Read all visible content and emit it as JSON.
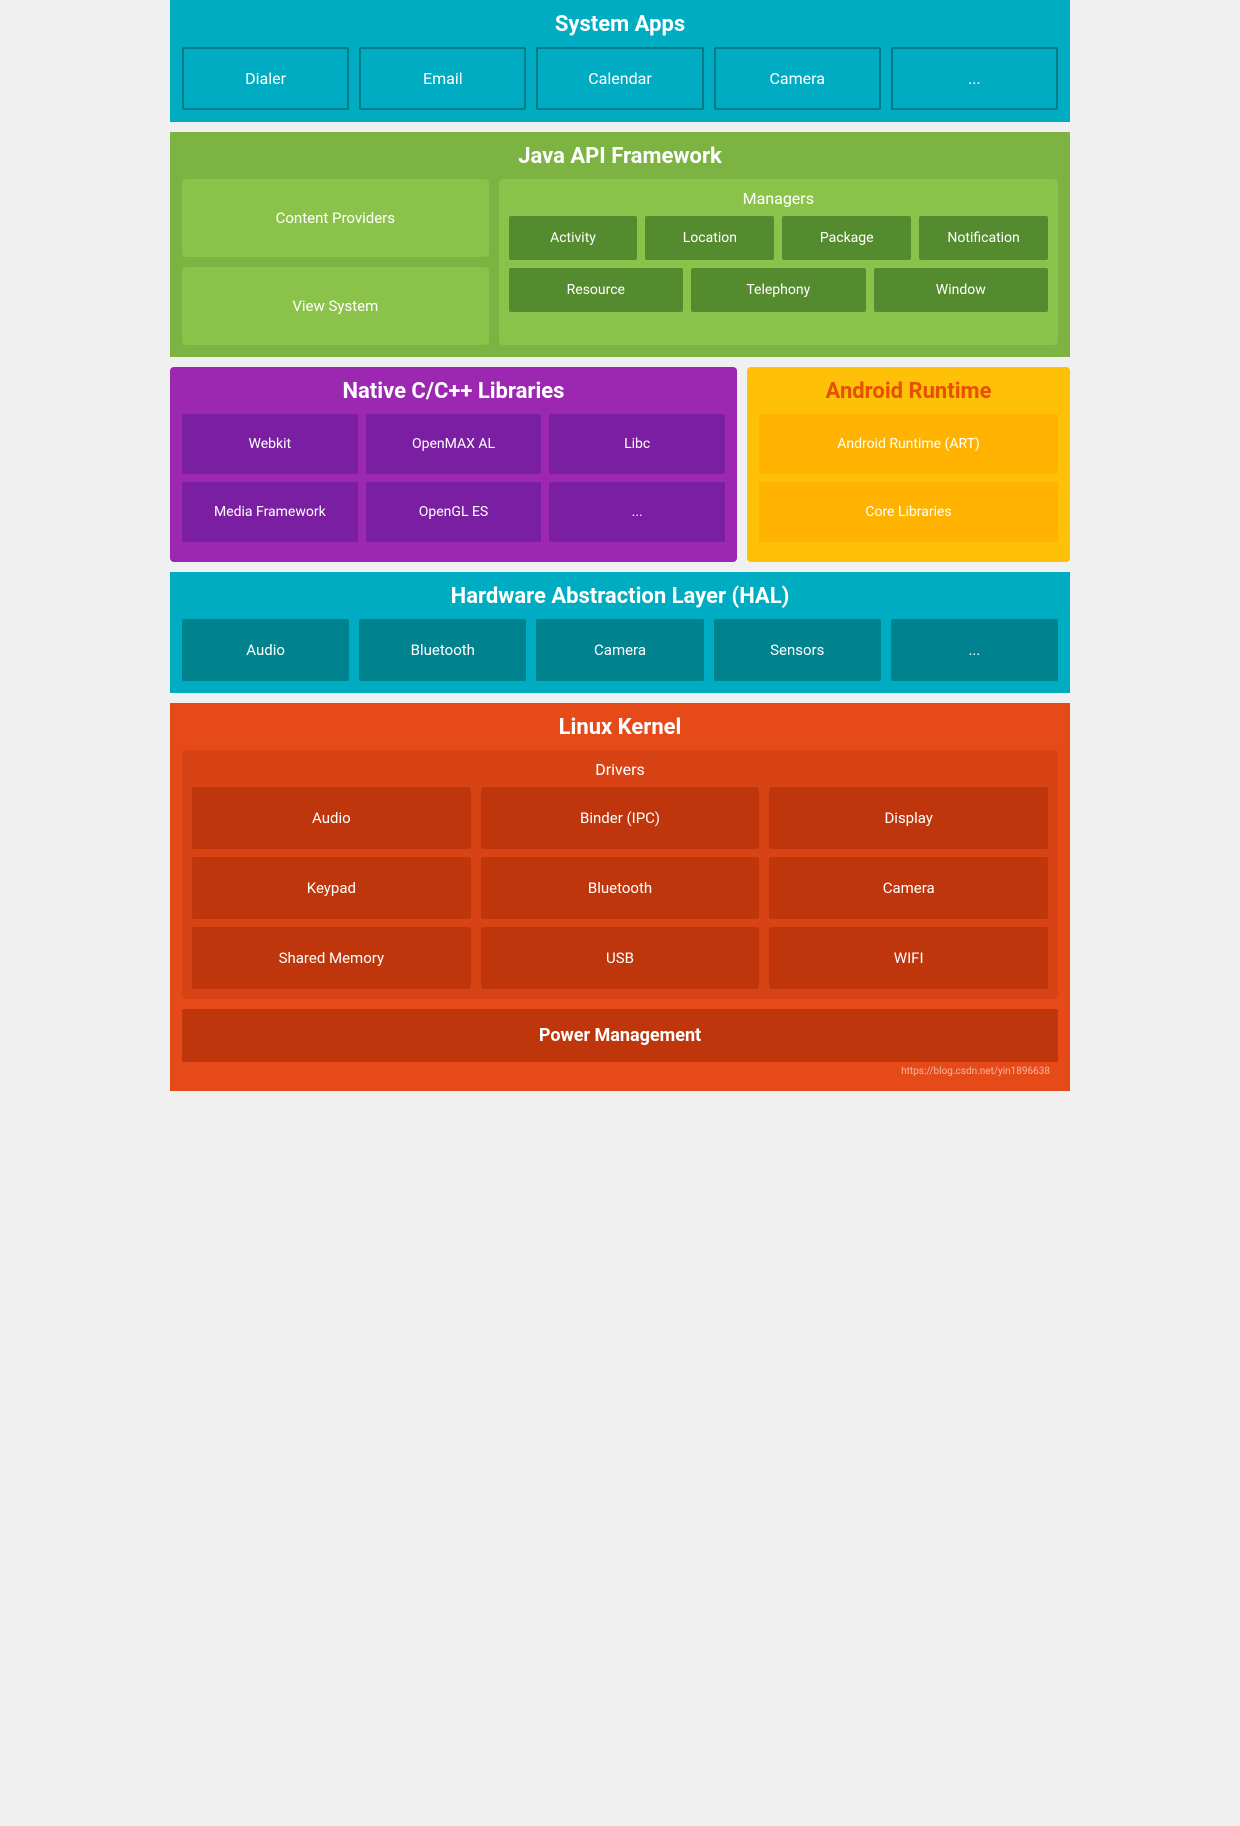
{
  "systemApps": {
    "title": "System Apps",
    "items": [
      "Dialer",
      "Email",
      "Calendar",
      "Camera",
      "..."
    ]
  },
  "javaAPI": {
    "title": "Java API Framework",
    "leftItems": [
      "Content Providers",
      "View System"
    ],
    "managers": {
      "title": "Managers",
      "row1": [
        "Activity",
        "Location",
        "Package",
        "Notification"
      ],
      "row2": [
        "Resource",
        "Telephony",
        "Window"
      ]
    }
  },
  "nativeCpp": {
    "title": "Native C/C++ Libraries",
    "row1": [
      "Webkit",
      "OpenMAX AL",
      "Libc"
    ],
    "row2": [
      "Media Framework",
      "OpenGL ES",
      "..."
    ]
  },
  "androidRuntime": {
    "title": "Android Runtime",
    "items": [
      "Android Runtime (ART)",
      "Core Libraries"
    ]
  },
  "hal": {
    "title": "Hardware Abstraction Layer (HAL)",
    "items": [
      "Audio",
      "Bluetooth",
      "Camera",
      "Sensors",
      "..."
    ]
  },
  "linuxKernel": {
    "title": "Linux Kernel",
    "drivers": {
      "title": "Drivers",
      "row1": [
        "Audio",
        "Binder (IPC)",
        "Display"
      ],
      "row2": [
        "Keypad",
        "Bluetooth",
        "Camera"
      ],
      "row3": [
        "Shared Memory",
        "USB",
        "WIFI"
      ]
    },
    "powerManagement": "Power Management"
  },
  "watermark": "https://blog.csdn.net/yin1896638"
}
